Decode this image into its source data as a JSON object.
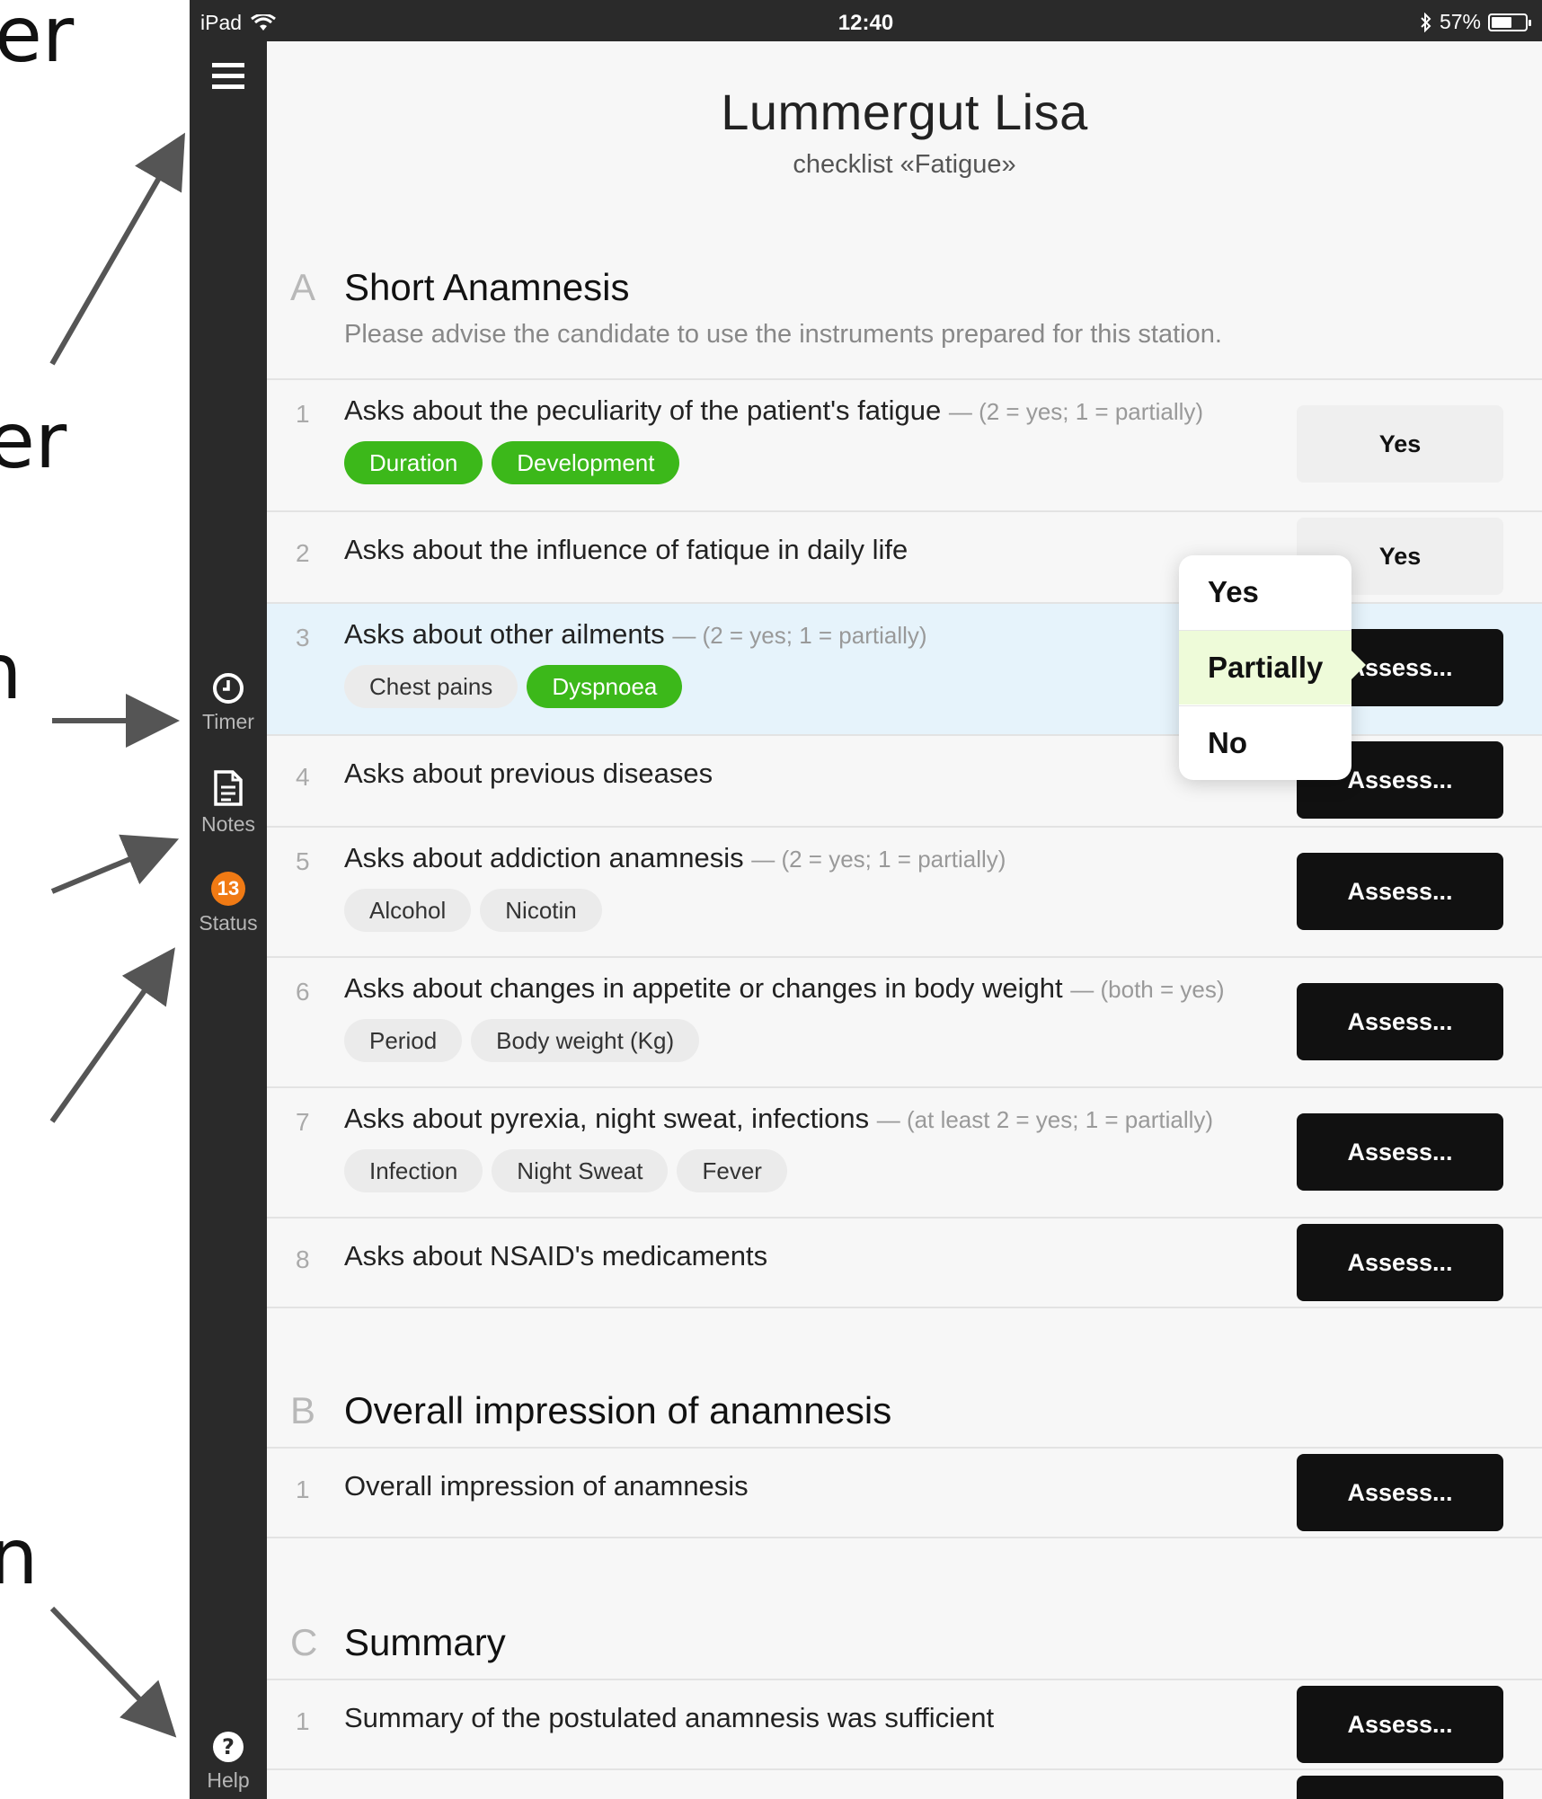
{
  "annotations": {
    "labels": [
      "er",
      "er",
      "n",
      "n"
    ]
  },
  "statusbar": {
    "device": "iPad",
    "time": "12:40",
    "battery": "57%"
  },
  "sidebar": {
    "timer": "Timer",
    "notes": "Notes",
    "status": "Status",
    "status_count": "13",
    "help": "Help"
  },
  "header": {
    "name": "Lummergut Lisa",
    "subtitle": "checklist «Fatigue»"
  },
  "sections": [
    {
      "letter": "A",
      "title": "Short Anamnesis",
      "desc": "Please advise the candidate to use the instruments prepared for this station.",
      "items": [
        {
          "num": "1",
          "text": "Asks about the peculiarity of the patient's fatigue",
          "hint": "— (2 = yes; 1 = partially)",
          "chips": [
            {
              "label": "Duration",
              "on": true
            },
            {
              "label": "Development",
              "on": true
            }
          ],
          "button": "Yes"
        },
        {
          "num": "2",
          "text": "Asks about the influence of fatique in daily life",
          "hint": "",
          "chips": [],
          "button": "Yes"
        },
        {
          "num": "3",
          "text": "Asks about other ailments",
          "hint": "— (2 = yes; 1 = partially)",
          "chips": [
            {
              "label": "Chest pains",
              "on": false
            },
            {
              "label": "Dyspnoea",
              "on": true
            }
          ],
          "button": "Assess..."
        },
        {
          "num": "4",
          "text": "Asks about previous diseases",
          "hint": "",
          "chips": [],
          "button": "Assess..."
        },
        {
          "num": "5",
          "text": "Asks about addiction anamnesis",
          "hint": "— (2 = yes; 1 = partially)",
          "chips": [
            {
              "label": "Alcohol",
              "on": false
            },
            {
              "label": "Nicotin",
              "on": false
            }
          ],
          "button": "Assess..."
        },
        {
          "num": "6",
          "text": "Asks about changes in appetite or changes in body weight",
          "hint": "— (both = yes)",
          "chips": [
            {
              "label": "Period",
              "on": false
            },
            {
              "label": "Body weight (Kg)",
              "on": false
            }
          ],
          "button": "Assess..."
        },
        {
          "num": "7",
          "text": "Asks about pyrexia, night sweat, infections",
          "hint": "— (at least 2 = yes; 1 = partially)",
          "chips": [
            {
              "label": "Infection",
              "on": false
            },
            {
              "label": "Night Sweat",
              "on": false
            },
            {
              "label": "Fever",
              "on": false
            }
          ],
          "button": "Assess..."
        },
        {
          "num": "8",
          "text": "Asks about NSAID's medicaments",
          "hint": "",
          "chips": [],
          "button": "Assess..."
        }
      ]
    },
    {
      "letter": "B",
      "title": "Overall impression of anamnesis",
      "items": [
        {
          "num": "1",
          "text": "Overall impression of anamnesis",
          "button": "Assess..."
        }
      ]
    },
    {
      "letter": "C",
      "title": "Summary",
      "items": [
        {
          "num": "1",
          "text": "Summary of the postulated anamnesis was sufficient",
          "button": "Assess..."
        }
      ]
    }
  ],
  "popover": {
    "options": [
      "Yes",
      "Partially",
      "No"
    ],
    "selected": "Partially"
  }
}
